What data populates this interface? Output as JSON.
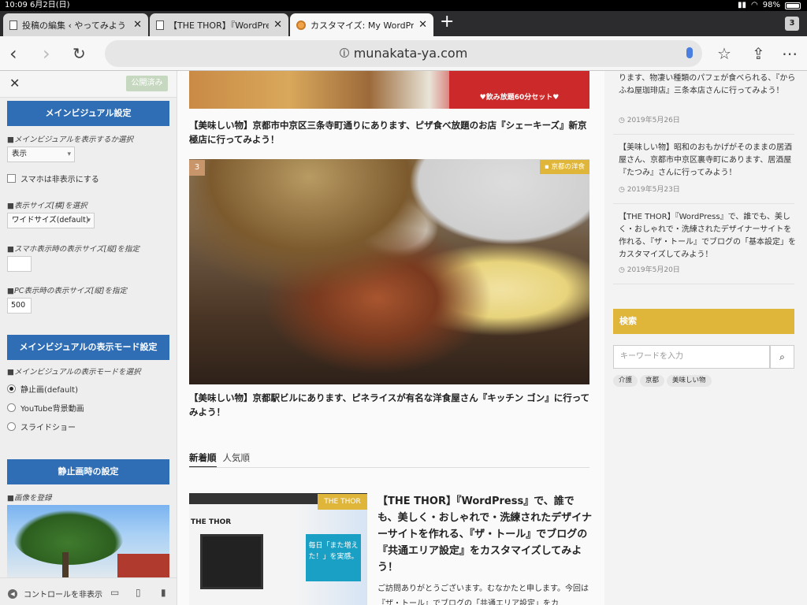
{
  "status_bar": {
    "time": "10:09",
    "date": "6月2日(日)",
    "battery": "98%"
  },
  "tabs": [
    {
      "title": "投稿の編集 ‹ やってみよう",
      "close": "✕"
    },
    {
      "title": "【THE THOR】『WordPress",
      "close": "✕"
    },
    {
      "title": "カスタマイズ: My WordPress",
      "close": "✕"
    }
  ],
  "tab_count": "3",
  "new_tab": "+",
  "url": "munakata-ya.com",
  "sidebar": {
    "close": "✕",
    "publish": "公開済み",
    "sections": {
      "main_visual": "メインビジュアル設定",
      "display_mode": "メインビジュアルの表示モード設定",
      "still_image": "静止画時の設定"
    },
    "labels": {
      "show_select": "■メインビジュアルを表示するか選択",
      "size_select": "■表示サイズ[横]を選択",
      "sp_size": "■スマホ表示時の表示サイズ[縦]を指定",
      "pc_size": "■PC表示時の表示サイズ[縦]を指定",
      "mode_select": "■メインビジュアルの表示モードを選択",
      "register_image": "■画像を登録"
    },
    "show_value": "表示",
    "hide_on_sp": "スマホは非表示にする",
    "size_value": "ワイドサイズ(default)",
    "sp_value": "",
    "pc_value": "500",
    "modes": [
      "静止画(default)",
      "YouTube背景動画",
      "スライドショー"
    ],
    "selected_mode": 0,
    "footer": {
      "hide_controls": "コントロールを非表示"
    }
  },
  "main": {
    "caption1": "【美味しい物】京都市中京区三条寺町通りにあります、ピザ食べ放題のお店『シェーキーズ』新京極店に行ってみよう！",
    "banner_text": "♥飲み放題60分セット♥",
    "rank": "3",
    "category": "京都の洋食",
    "caption2": "【美味しい物】京都駅ビルにあります、ピネライスが有名な洋食屋さん『キッチン ゴン』に行ってみよう！",
    "tab_new": "新着順",
    "tab_popular": "人気順",
    "post_badge": "THE THOR",
    "thumb_logo": "THE THOR",
    "thumb_copy": "毎日「また増えた！」を実感。",
    "post_title": "【THE THOR】『WordPress』で、誰でも、美しく・おしゃれで・洗練されたデザイナーサイトを作れる、『ザ・トール』でブログの『共通エリア設定』をカスタマイズしてみよう！",
    "post_excerpt": "ご訪問ありがとうございます。むなかたと申します。今回は『ザ・トール』でブログの「共通エリア設定」をカ"
  },
  "right": {
    "posts": [
      {
        "text": "ります、物凄い種類のパフェが食べられる、『からふね屋珈琲店』三条本店さんに行ってみよう！",
        "date": "2019年5月26日"
      },
      {
        "text": "【美味しい物】昭和のおもかげがそのままの居酒屋さん、京都市中京区裏寺町にあります、居酒屋『たつみ』さんに行ってみよう！",
        "date": "2019年5月23日"
      },
      {
        "text": "【THE THOR】『WordPress』で、誰でも、美しく・おしゃれで・洗練されたデザイナーサイトを作れる、『ザ・トール』でブログの「基本設定」をカスタマイズしてみよう！",
        "date": "2019年5月20日"
      }
    ],
    "search_title": "検索",
    "search_placeholder": "キーワードを入力",
    "tags": [
      "介護",
      "京都",
      "美味しい物"
    ]
  },
  "colors": {
    "accent_blue": "#2f6eb5",
    "accent_gold": "#e0b63a"
  },
  "icons": [
    "doc-icon",
    "favicon-icon",
    "back-icon",
    "forward-icon",
    "reload-icon",
    "info-icon",
    "mic-icon",
    "bookmark-star-icon",
    "share-icon",
    "more-icon",
    "search-icon",
    "clock-icon",
    "desktop-icon",
    "tablet-icon",
    "mobile-icon"
  ]
}
